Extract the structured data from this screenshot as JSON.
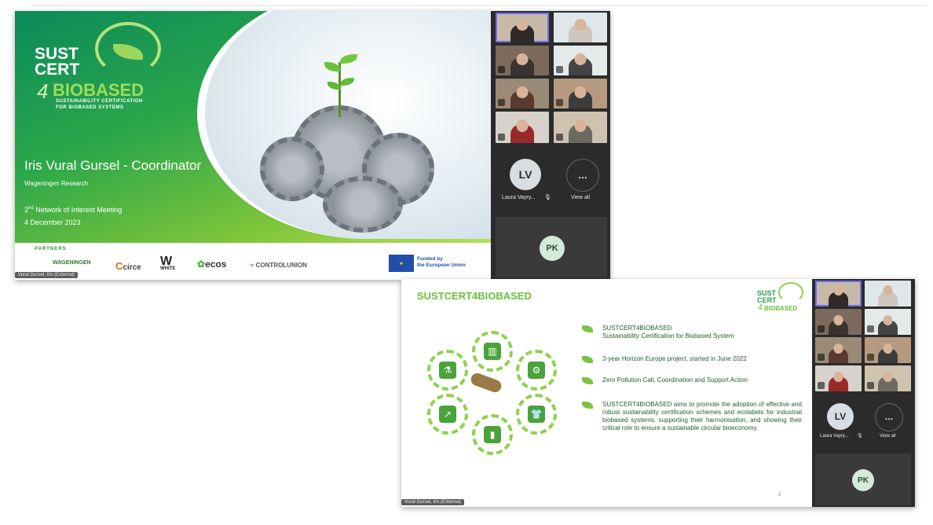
{
  "screenshot1": {
    "slide": {
      "logo": {
        "line1": "SUST",
        "line2": "CERT",
        "digit": "4",
        "word": "BIOBASED",
        "tagline1": "SUSTAINABILITY CERTIFICATION",
        "tagline2": "FOR BIOBASED SYSTEMS"
      },
      "presenter": "Iris Vural Gursel - Coordinator",
      "organisation": "Wageningen Research",
      "meeting_num": "2",
      "meeting_sup": "nd",
      "meeting_rest": " Network of Interest Meeting",
      "date": "4 December 2023",
      "partners_heading": "PARTNERS",
      "partners": [
        "WAGENINGEN",
        "circe",
        "WHITE",
        "ecos",
        "CONTROLUNION"
      ],
      "eu_funding": [
        "Funded by",
        "the European Union"
      ]
    },
    "name_bar": "Vural Gursel, Iris (External)",
    "participants": {
      "lv_initials": "LV",
      "lv_name": "Laura Vayry...",
      "view_all_label": "View all",
      "more_glyph": "…",
      "pk_initials": "PK"
    }
  },
  "screenshot2": {
    "slide": {
      "title": "SUSTCERT4BIOBASED",
      "logo": {
        "line1": "SUST",
        "line2": "CERT",
        "digit": "4",
        "word": "BIOBASED"
      },
      "bullets": [
        {
          "text": "SUSTCERT4BIOBASED"
        },
        {
          "text": "3-year Horizon Europe project, started in June 2022"
        },
        {
          "text": "Zero Pollution Call, Coordination and Support Action"
        },
        {
          "text": "SUSTCERT4BIOBASED aims to promote the adoption of effective and robust sustainability certification schemes and ecolabels for industrial biobased systems, supporting their harmonisation, and showing their critical role to ensure a sustainable circular bioeconomy."
        }
      ],
      "bullet1_sub": "Sustainability Certification for Biobased System",
      "page_number": "2"
    },
    "name_bar": "Vural Gursel, Iris (External)",
    "participants": {
      "lv_initials": "LV",
      "lv_name": "Laura Vayry...",
      "view_all_label": "View all",
      "more_glyph": "…",
      "pk_initials": "PK"
    }
  },
  "colors": {
    "brand_green": "#6abf3b",
    "dark_green": "#0c8a5a",
    "panel_dark": "#2b2b2b",
    "eu_blue": "#1f4fa8"
  }
}
